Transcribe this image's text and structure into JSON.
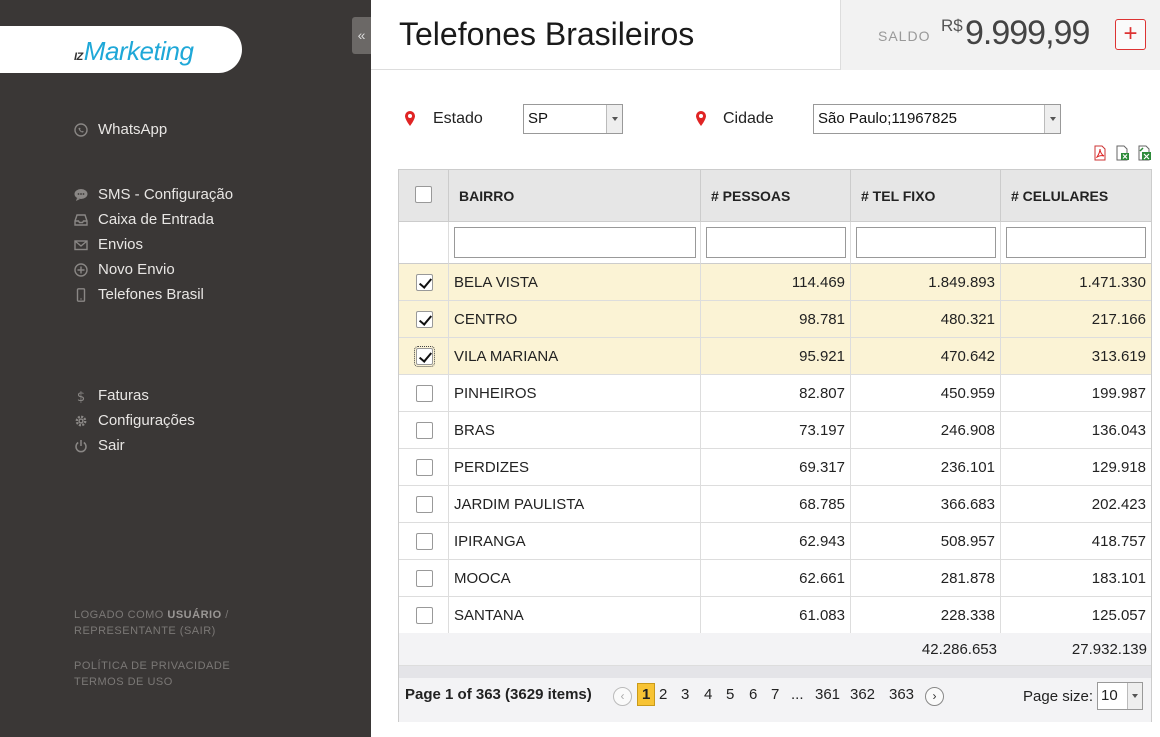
{
  "logo": {
    "prefix": "IZ",
    "name": "Marketing"
  },
  "sidebar": {
    "collapse_glyph": "«",
    "group1": [
      {
        "label": "WhatsApp",
        "icon": "whatsapp-icon"
      }
    ],
    "group2": [
      {
        "label": "SMS - Configuração",
        "icon": "chat-icon"
      },
      {
        "label": "Caixa de Entrada",
        "icon": "inbox-icon"
      },
      {
        "label": "Envios",
        "icon": "mail-icon"
      },
      {
        "label": "Novo Envio",
        "icon": "plus-circle-icon"
      },
      {
        "label": "Telefones Brasil",
        "icon": "phone-icon"
      }
    ],
    "group3": [
      {
        "label": "Faturas",
        "icon": "dollar-icon"
      },
      {
        "label": "Configurações",
        "icon": "gear-icon"
      },
      {
        "label": "Sair",
        "icon": "power-icon"
      }
    ],
    "footer": {
      "logged_as": "LOGADO COMO",
      "user": "USUÁRIO",
      "sep": "/",
      "rep": "REPRESENTANTE (SAIR)",
      "privacy": "POLÍTICA DE PRIVACIDADE",
      "terms": "TERMOS DE USO"
    }
  },
  "header": {
    "title": "Telefones Brasileiros",
    "saldo_label": "SALDO",
    "currency": "R$",
    "amount": "9.999,99",
    "add_glyph": "+"
  },
  "filters": {
    "estado_label": "Estado",
    "estado_value": "SP",
    "cidade_label": "Cidade",
    "cidade_value": "São Paulo;11967825"
  },
  "grid": {
    "columns": [
      "BAIRRO",
      "# PESSOAS",
      "# TEL FIXO",
      "# CELULARES"
    ],
    "rows": [
      {
        "bairro": "BELA VISTA",
        "pessoas": "114.469",
        "fixo": "1.849.893",
        "celulares": "1.471.330",
        "checked": true
      },
      {
        "bairro": "CENTRO",
        "pessoas": "98.781",
        "fixo": "480.321",
        "celulares": "217.166",
        "checked": true
      },
      {
        "bairro": "VILA MARIANA",
        "pessoas": "95.921",
        "fixo": "470.642",
        "celulares": "313.619",
        "checked": true
      },
      {
        "bairro": "PINHEIROS",
        "pessoas": "82.807",
        "fixo": "450.959",
        "celulares": "199.987",
        "checked": false
      },
      {
        "bairro": "BRAS",
        "pessoas": "73.197",
        "fixo": "246.908",
        "celulares": "136.043",
        "checked": false
      },
      {
        "bairro": "PERDIZES",
        "pessoas": "69.317",
        "fixo": "236.101",
        "celulares": "129.918",
        "checked": false
      },
      {
        "bairro": "JARDIM PAULISTA",
        "pessoas": "68.785",
        "fixo": "366.683",
        "celulares": "202.423",
        "checked": false
      },
      {
        "bairro": "IPIRANGA",
        "pessoas": "62.943",
        "fixo": "508.957",
        "celulares": "418.757",
        "checked": false
      },
      {
        "bairro": "MOOCA",
        "pessoas": "62.661",
        "fixo": "281.878",
        "celulares": "183.101",
        "checked": false
      },
      {
        "bairro": "SANTANA",
        "pessoas": "61.083",
        "fixo": "228.338",
        "celulares": "125.057",
        "checked": false
      }
    ],
    "totals": {
      "fixo": "42.286.653",
      "celulares": "27.932.139"
    }
  },
  "pager": {
    "info": "Page 1 of 363 (3629 items)",
    "pages": [
      "1",
      "2",
      "3",
      "4",
      "5",
      "6",
      "7",
      "...",
      "361",
      "362",
      "363"
    ],
    "current": "1",
    "page_size_label": "Page size:",
    "page_size": "10"
  },
  "colors": {
    "accent": "#1fa8d8",
    "selected_row": "#fbf3d5",
    "current_page": "#f7c334",
    "danger": "#dd3333"
  }
}
